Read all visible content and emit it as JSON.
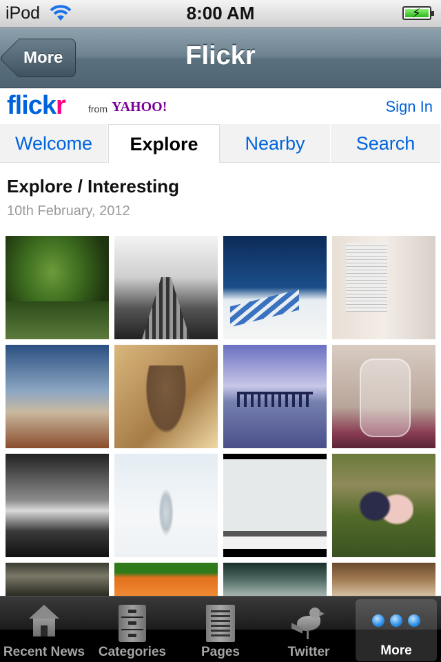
{
  "status_bar": {
    "carrier": "iPod",
    "time": "8:00 AM"
  },
  "nav_bar": {
    "title": "Flickr",
    "back_label": "More"
  },
  "flickr": {
    "logo_main": "flick",
    "logo_r": "r",
    "logo_from": "from",
    "logo_yahoo": "YAHOO!",
    "sign_in": "Sign In"
  },
  "tabs": [
    {
      "label": "Welcome",
      "active": false
    },
    {
      "label": "Explore",
      "active": true
    },
    {
      "label": "Nearby",
      "active": false
    },
    {
      "label": "Search",
      "active": false
    }
  ],
  "section": {
    "title": "Explore / Interesting",
    "date": "10th February, 2012"
  },
  "photos": [
    "leaf-with-ladybug",
    "cobblestone-path-bw",
    "beach-loungers",
    "open-book",
    "desert-landscape",
    "deer",
    "bridge-reflection",
    "jar-with-flowers",
    "pier-bw",
    "snowy-tree",
    "snowy-field",
    "couple-with-banjo",
    "chandelier",
    "orange-petals",
    "window-room",
    "feathers"
  ],
  "tab_bar": {
    "items": [
      {
        "label": "Recent News",
        "icon": "house-icon"
      },
      {
        "label": "Categories",
        "icon": "cabinet-icon"
      },
      {
        "label": "Pages",
        "icon": "pages-icon"
      },
      {
        "label": "Twitter",
        "icon": "bird-icon"
      },
      {
        "label": "More",
        "icon": "more-dots-icon",
        "selected": true
      }
    ]
  },
  "colors": {
    "flickr_blue": "#0063dc",
    "flickr_pink": "#ff0084",
    "yahoo_purple": "#7b0099",
    "nav_bar": "#5a707e"
  }
}
